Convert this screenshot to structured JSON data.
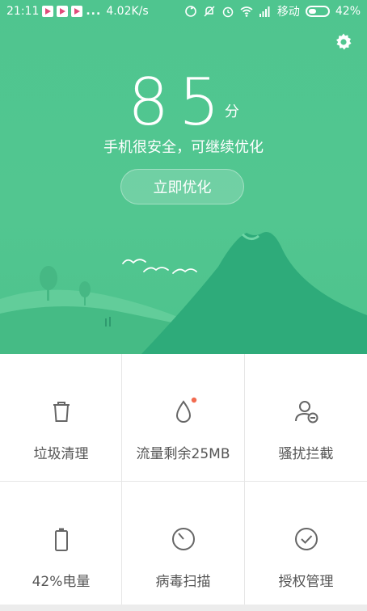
{
  "status_bar": {
    "time": "21:11",
    "more": "...",
    "speed": "4.02K/s",
    "carrier": "移动",
    "battery": "42%",
    "battery_level": 0.42
  },
  "header": {
    "score": "85",
    "score_unit": "分",
    "status": "手机很安全，可继续优化",
    "optimize_label": "立即优化"
  },
  "tools": [
    {
      "label": "垃圾清理",
      "icon": "trash-icon"
    },
    {
      "label": "流量剩余25MB",
      "icon": "data-drop-icon"
    },
    {
      "label": "骚扰拦截",
      "icon": "user-block-icon"
    },
    {
      "label": "42%电量",
      "icon": "battery-icon"
    },
    {
      "label": "病毒扫描",
      "icon": "virus-scan-icon"
    },
    {
      "label": "授权管理",
      "icon": "permission-check-icon"
    }
  ],
  "colors": {
    "accent": "#52c690",
    "hill": "#2fae7c",
    "notify_dot": "#f26b50"
  }
}
